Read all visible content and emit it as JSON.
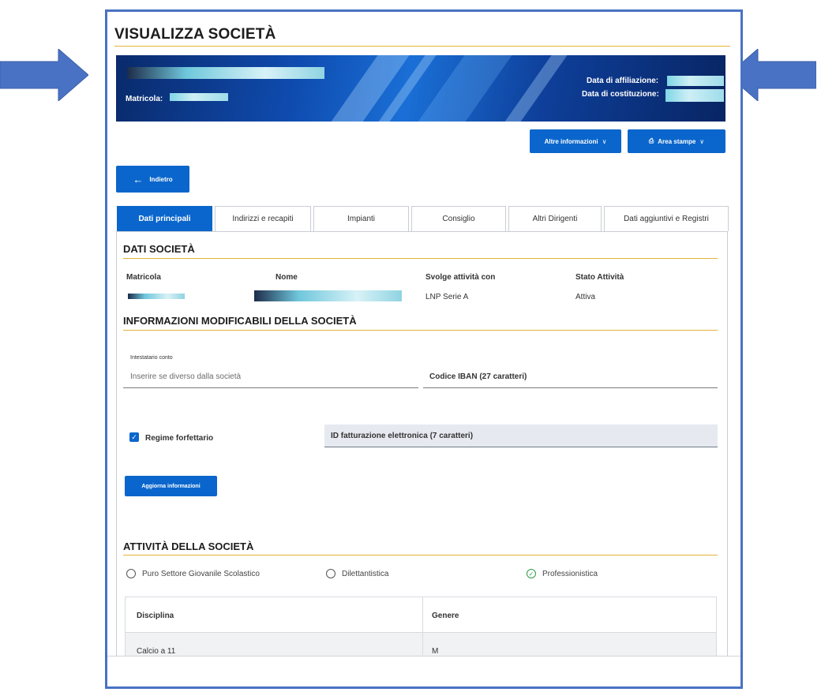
{
  "page": {
    "title": "VISUALIZZA SOCIETÀ"
  },
  "banner": {
    "matricola_label": "Matricola:",
    "affiliazione_label": "Data di affiliazione:",
    "costituzione_label": "Data di costituzione:"
  },
  "toolbar": {
    "altre_info_label": "Altre informazioni",
    "area_stampe_label": "Area stampe",
    "back_label": "Indietro"
  },
  "tabs": [
    {
      "label": "Dati principali",
      "active": true
    },
    {
      "label": "Indirizzi e recapiti"
    },
    {
      "label": "Impianti"
    },
    {
      "label": "Consiglio"
    },
    {
      "label": "Altri Dirigenti"
    },
    {
      "label": "Dati aggiuntivi e Registri"
    }
  ],
  "dati_societa": {
    "title": "DATI SOCIETÀ",
    "headers": {
      "matricola": "Matricola",
      "nome": "Nome",
      "attivita": "Svolge attività con",
      "stato": "Stato Attività"
    },
    "values": {
      "attivita": "LNP Serie A",
      "stato": "Attiva"
    }
  },
  "info_modificabili": {
    "title": "INFORMAZIONI MODIFICABILI DELLA SOCIETÀ",
    "intestatario_label": "Intestatario conto",
    "intestatario_placeholder": "Inserire se diverso dalla società",
    "iban_label": "Codice IBAN (27 caratteri)",
    "regime_label": "Regime forfettario",
    "regime_checked": true,
    "fattura_label": "ID fatturazione elettronica (7 caratteri)",
    "update_button": "Aggiorna informazioni"
  },
  "attivita_societa": {
    "title": "ATTIVITÀ DELLA SOCIETÀ",
    "options": [
      {
        "label": "Puro Settore Giovanile Scolastico",
        "selected": false
      },
      {
        "label": "Dilettantistica",
        "selected": false
      },
      {
        "label": "Professionistica",
        "selected": true
      }
    ],
    "table": {
      "headers": [
        "Disciplina",
        "Genere"
      ],
      "rows": [
        [
          "Calcio a 11",
          "M"
        ]
      ]
    }
  },
  "colors": {
    "primary": "#0a66cc",
    "accent_rule": "#e3b43c",
    "frame": "#4a72c4",
    "arrow": "#4a72c4",
    "success": "#2a9d4a"
  },
  "icons": [
    "arrow-right-icon",
    "arrow-left-icon",
    "back-arrow-icon",
    "chevron-down-icon",
    "printer-icon",
    "checkbox-checked-icon",
    "radio-icon",
    "check-circle-icon"
  ]
}
